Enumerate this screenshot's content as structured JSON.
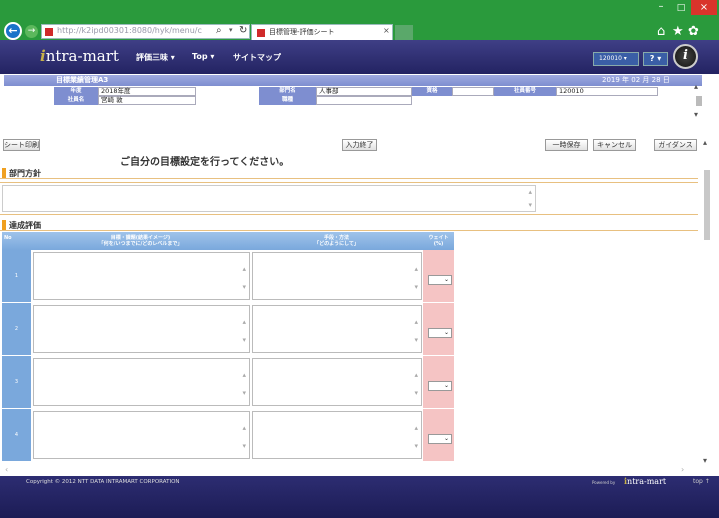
{
  "browser": {
    "url": "http://k2ipd00301:8080/hyk/menu/c",
    "tab_title": "目標管理-評価シート",
    "tab_close": "×",
    "back": "←",
    "forward": "→",
    "search_icon": "⌕",
    "dropdown": "▾",
    "refresh": "↻",
    "minimize": "–",
    "maximize": "□",
    "close": "×",
    "home_icon": "⌂",
    "star_icon": "★",
    "gear_icon": "✿"
  },
  "header": {
    "logo_prefix": "i",
    "logo_text": "ntra-mart",
    "menu": [
      "評価三味 ▾",
      "Top ▾",
      "サイトマップ"
    ],
    "user_select": "120010 ▾",
    "help": "? ▾",
    "info": "i"
  },
  "summary": {
    "title": "目標業績管理A3",
    "date": "2019 年 02 月 28 日",
    "labels": {
      "year": "年度",
      "employee_name": "社員名",
      "department": "部門名",
      "position_title": "職種",
      "grade": "資格",
      "employee_no": "社員番号"
    },
    "values": {
      "year": "2018年度",
      "employee_name": "宮崎 敦",
      "department": "人事部",
      "position_title": "",
      "grade": "",
      "employee_no": "120010"
    }
  },
  "buttons": {
    "print": "シート印刷",
    "input_done": "入力終了",
    "temp_save": "一時保存",
    "cancel": "キャンセル",
    "guidance": "ガイダンス"
  },
  "instruction": "ご自分の目標設定を行ってください。",
  "policy_section": {
    "title": "部門方針"
  },
  "eval_section": {
    "title": "達成評価",
    "columns": {
      "no": "No",
      "goal_line1": "目標・課題(結果イメージ)",
      "goal_line2": "「何を/いつまでに/どのレベルまで」",
      "method_line1": "手段・方法",
      "method_line2": "「どのようにして」",
      "weight_line1": "ウェイト",
      "weight_line2": "(%)"
    },
    "rows": [
      "1",
      "2",
      "3",
      "4"
    ],
    "select_arrow": "⌄"
  },
  "scroll": {
    "up": "▴",
    "down": "▾",
    "left": "‹",
    "right": "›"
  },
  "footer": {
    "copyright": "Copyright © 2012 NTT DATA INTRAMART CORPORATION",
    "powered": "Powered by",
    "logo_prefix": "i",
    "logo_text": "ntra-mart",
    "top": "top ↑"
  },
  "colors": {
    "browser_chrome": "#2a9a3c",
    "app_header": "#2f2f72",
    "label_blue": "#7e8ed0",
    "table_blue": "#7aa8dc",
    "weight_pink": "#f5c4c4",
    "section_orange": "#f0a020"
  }
}
